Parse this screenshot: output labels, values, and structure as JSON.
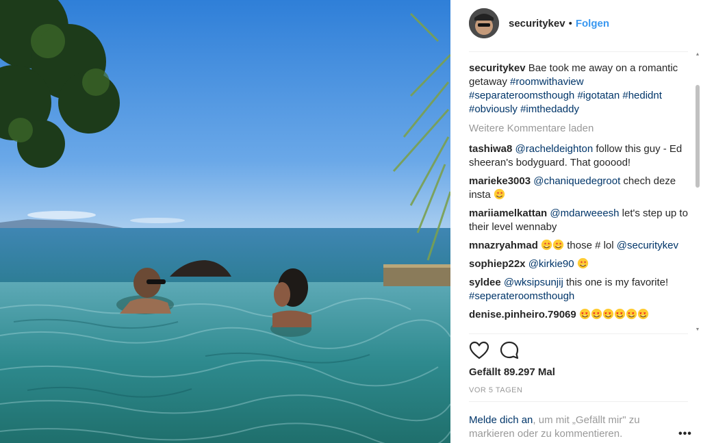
{
  "post": {
    "username": "securitykev",
    "separator": "•",
    "follow_label": "Folgen"
  },
  "caption": {
    "username": "securitykev",
    "text": "Bae took me away on a romantic getaway ",
    "hashtags": [
      "#roomwithaview",
      "#separateroomsthough",
      "#igotatan",
      "#hedidnt",
      "#obviously",
      "#imthedaddy"
    ]
  },
  "load_more_label": "Weitere Kommentare laden",
  "comments": [
    {
      "user": "tashiwa8",
      "mention": "@racheldeighton",
      "text": " follow this guy - Ed sheeran's bodyguard. That gooood!",
      "emoji": ""
    },
    {
      "user": "marieke3003",
      "mention": "@chaniquedegroot",
      "text": " chech deze insta",
      "emoji": "starstruck"
    },
    {
      "user": "mariiamelkattan",
      "mention": "@mdarweeesh",
      "text": " let's step up to their level wennaby",
      "emoji": ""
    },
    {
      "user": "mnazryahmad",
      "mention": "",
      "text": " those # lol",
      "emoji": "starstruck2",
      "mention_after": "@securitykev"
    },
    {
      "user": "sophiep22x",
      "mention": "@kirkie90",
      "text": " ",
      "emoji": "starstruck"
    },
    {
      "user": "syldee",
      "mention": "@wksipsunjij",
      "text": " this one is my favorite! ",
      "emoji": "",
      "tag_after": "#seperateroomsthough"
    },
    {
      "user": "denise.pinheiro.79069",
      "mention": "",
      "text": " ",
      "emoji": "hearteyes6"
    }
  ],
  "icons": {
    "like": "heart-icon",
    "comment": "comment-bubble-icon",
    "more": "more-options-icon"
  },
  "likes_text": "Gefällt 89.297 Mal",
  "timestamp": "VOR 5 TAGEN",
  "login": {
    "link_label": "Melde dich an",
    "rest_text": ", um mit „Gefällt mir\" zu markieren oder zu kommentieren."
  },
  "more_label": "•••",
  "colors": {
    "link": "#3897f0",
    "tag": "#003569",
    "muted": "#999999"
  }
}
